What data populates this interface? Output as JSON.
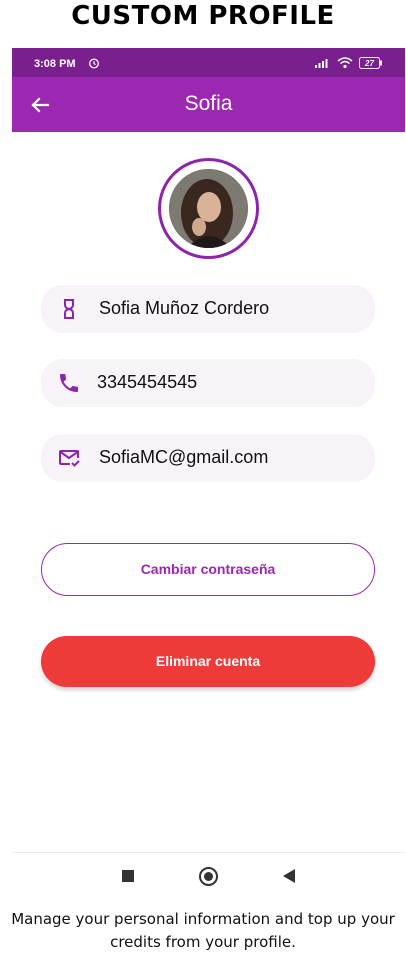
{
  "page_heading": "CUSTOM PROFILE",
  "status_bar": {
    "time": "3:08 PM",
    "battery": "27",
    "icons": [
      "alarm-icon",
      "signal-icon",
      "wifi-icon",
      "battery-icon"
    ]
  },
  "app_bar": {
    "title": "Sofia",
    "back_icon": "arrow-back-icon"
  },
  "profile": {
    "avatar": "profile-photo",
    "fields": {
      "name": {
        "icon": "person-icon",
        "value": "Sofia Muñoz Cordero"
      },
      "phone": {
        "icon": "phone-icon",
        "value": "3345454545"
      },
      "email": {
        "icon": "mail-check-icon",
        "value": "SofiaMC@gmail.com"
      }
    }
  },
  "actions": {
    "change_password_label": "Cambiar contraseña",
    "delete_account_label": "Eliminar cuenta"
  },
  "nav_bar": {
    "icons": [
      "recent-apps-icon",
      "home-icon",
      "back-icon"
    ]
  },
  "caption": "Manage your personal information and top up your credits from your profile.",
  "colors": {
    "primary": "#9c27b0",
    "status_bar": "#7a1f8e",
    "field_background": "#f8f2f9",
    "danger": "#ee3a39"
  }
}
